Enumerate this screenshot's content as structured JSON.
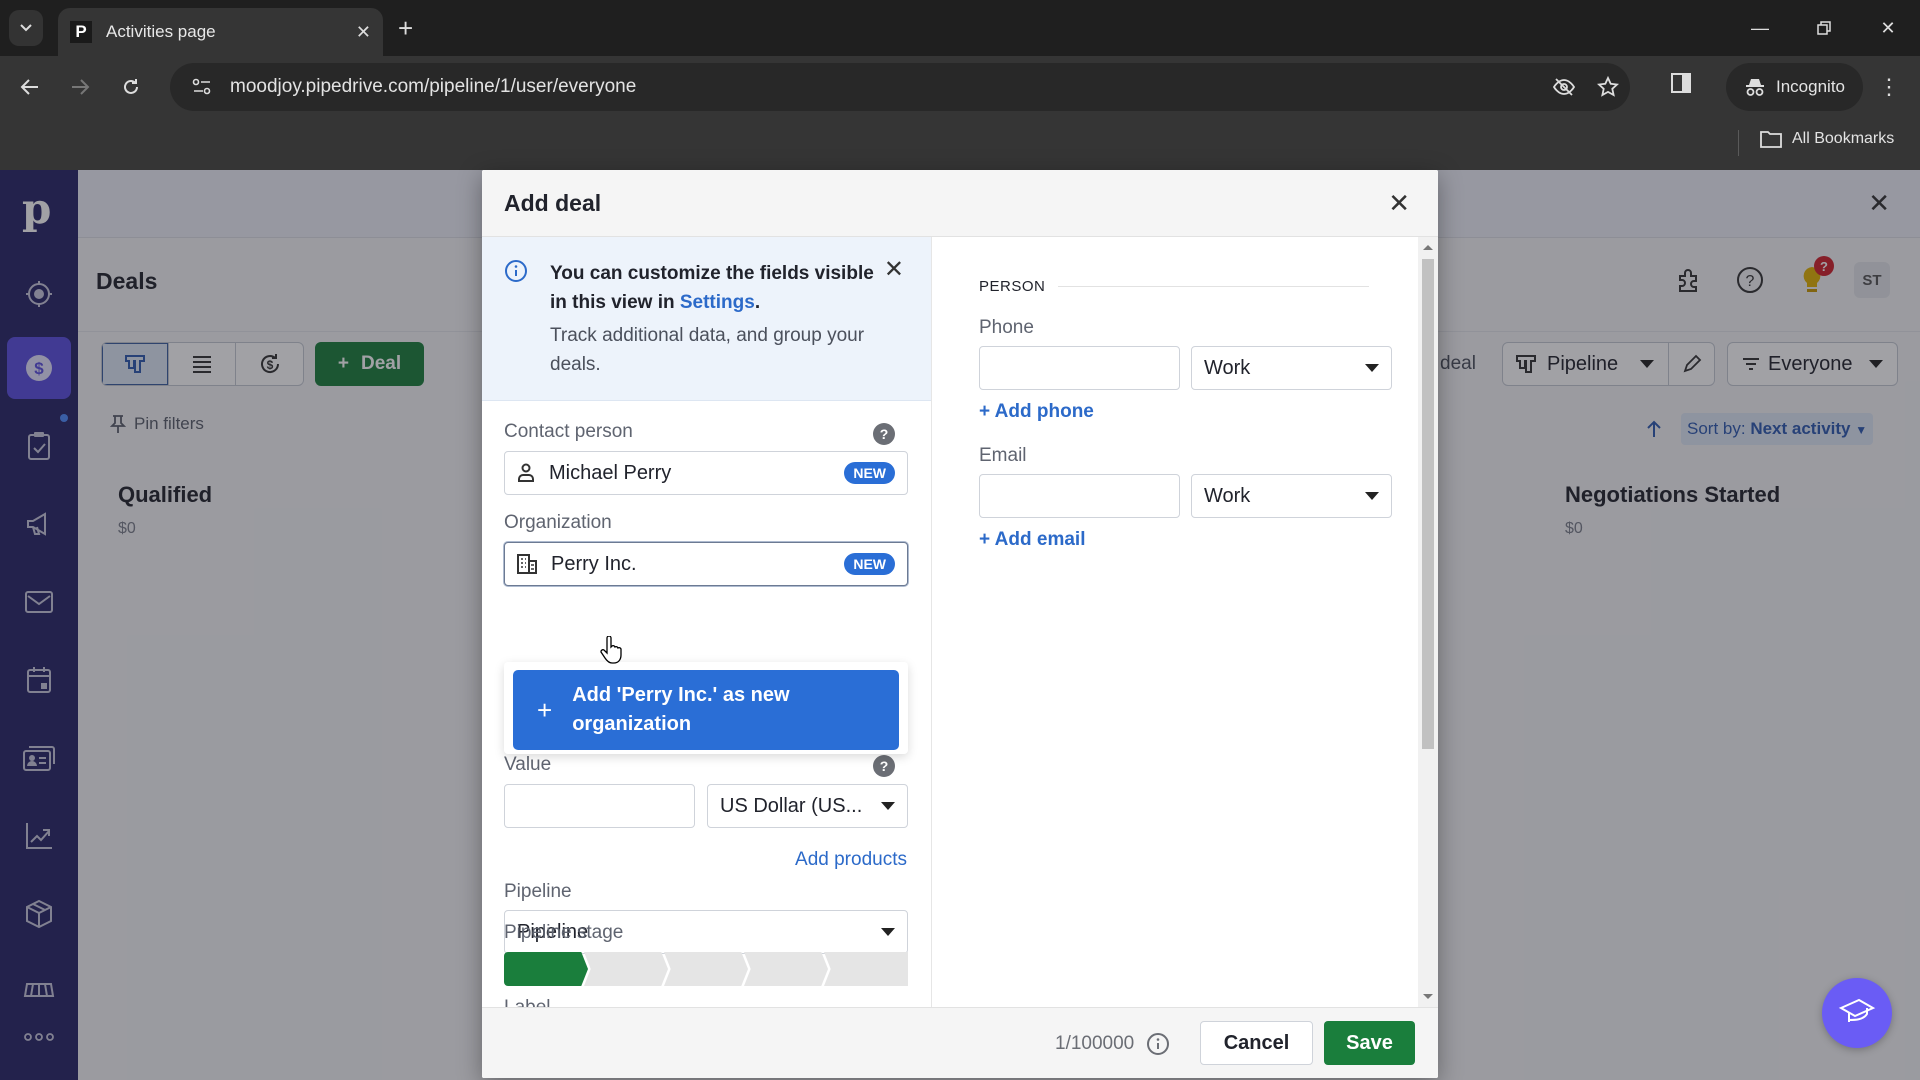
{
  "browser": {
    "tab_title": "Activities page",
    "tab_favicon": "P",
    "url": "moodjoy.pipedrive.com/pipeline/1/user/everyone",
    "incognito_label": "Incognito",
    "all_bookmarks_label": "All Bookmarks"
  },
  "app": {
    "logo": "p",
    "sidebar_items": [
      {
        "name": "leads",
        "icon": "target-icon"
      },
      {
        "name": "deals",
        "icon": "dollar-icon",
        "active": true
      },
      {
        "name": "activities",
        "icon": "clipboard-check-icon"
      },
      {
        "name": "campaigns",
        "icon": "megaphone-icon"
      },
      {
        "name": "mail",
        "icon": "mail-icon"
      },
      {
        "name": "calendar",
        "icon": "calendar-icon"
      },
      {
        "name": "contacts",
        "icon": "contact-card-icon"
      },
      {
        "name": "insights",
        "icon": "chart-icon"
      },
      {
        "name": "products",
        "icon": "box-icon"
      },
      {
        "name": "marketplace",
        "icon": "store-icon"
      },
      {
        "name": "more",
        "icon": "more-icon"
      }
    ],
    "page_title": "Deals",
    "add_deal_label": "Deal",
    "pin_filters_label": "Pin filters",
    "deal_ghost_text": "deal",
    "pipeline_label": "Pipeline",
    "everyone_label": "Everyone",
    "sort_prefix": "Sort by:",
    "sort_value": "Next activity",
    "notification_badge": "?",
    "avatar_initials": "ST",
    "stages": [
      {
        "title": "Qualified",
        "value": "$0"
      },
      {
        "title": "Negotiations Started",
        "value": "$0"
      }
    ]
  },
  "modal": {
    "title": "Add deal",
    "banner": {
      "line1": "You can customize the fields visible in this view in",
      "link": "Settings",
      "after_link": ".",
      "line2": "Track additional data, and group your deals."
    },
    "contact_person": {
      "label": "Contact person",
      "value": "Michael Perry",
      "badge": "NEW"
    },
    "organization": {
      "label": "Organization",
      "value": "Perry Inc.",
      "badge": "NEW"
    },
    "org_dropdown_option": "Add 'Perry Inc.' as new organization",
    "value_field": {
      "label": "Value",
      "value": "",
      "currency": "US Dollar (US..."
    },
    "add_products_label": "Add products",
    "pipeline_field": {
      "label": "Pipeline",
      "value": "Pipeline"
    },
    "pipeline_stage": {
      "label": "Pipeline stage",
      "total_stages": 5,
      "current_stage": 1
    },
    "next_label_cut": "Label",
    "person_section": {
      "title": "PERSON",
      "phone": {
        "label": "Phone",
        "value": "",
        "type": "Work",
        "add_label": "+ Add phone"
      },
      "email": {
        "label": "Email",
        "value": "",
        "type": "Work",
        "add_label": "+ Add email"
      }
    },
    "footer": {
      "counter": "1/100000",
      "cancel_label": "Cancel",
      "save_label": "Save"
    }
  },
  "colors": {
    "primary_green": "#1a7e3c",
    "accent_blue": "#2a6ed6",
    "sidebar_bg": "#262566",
    "sidebar_active": "#5b4fe0"
  }
}
